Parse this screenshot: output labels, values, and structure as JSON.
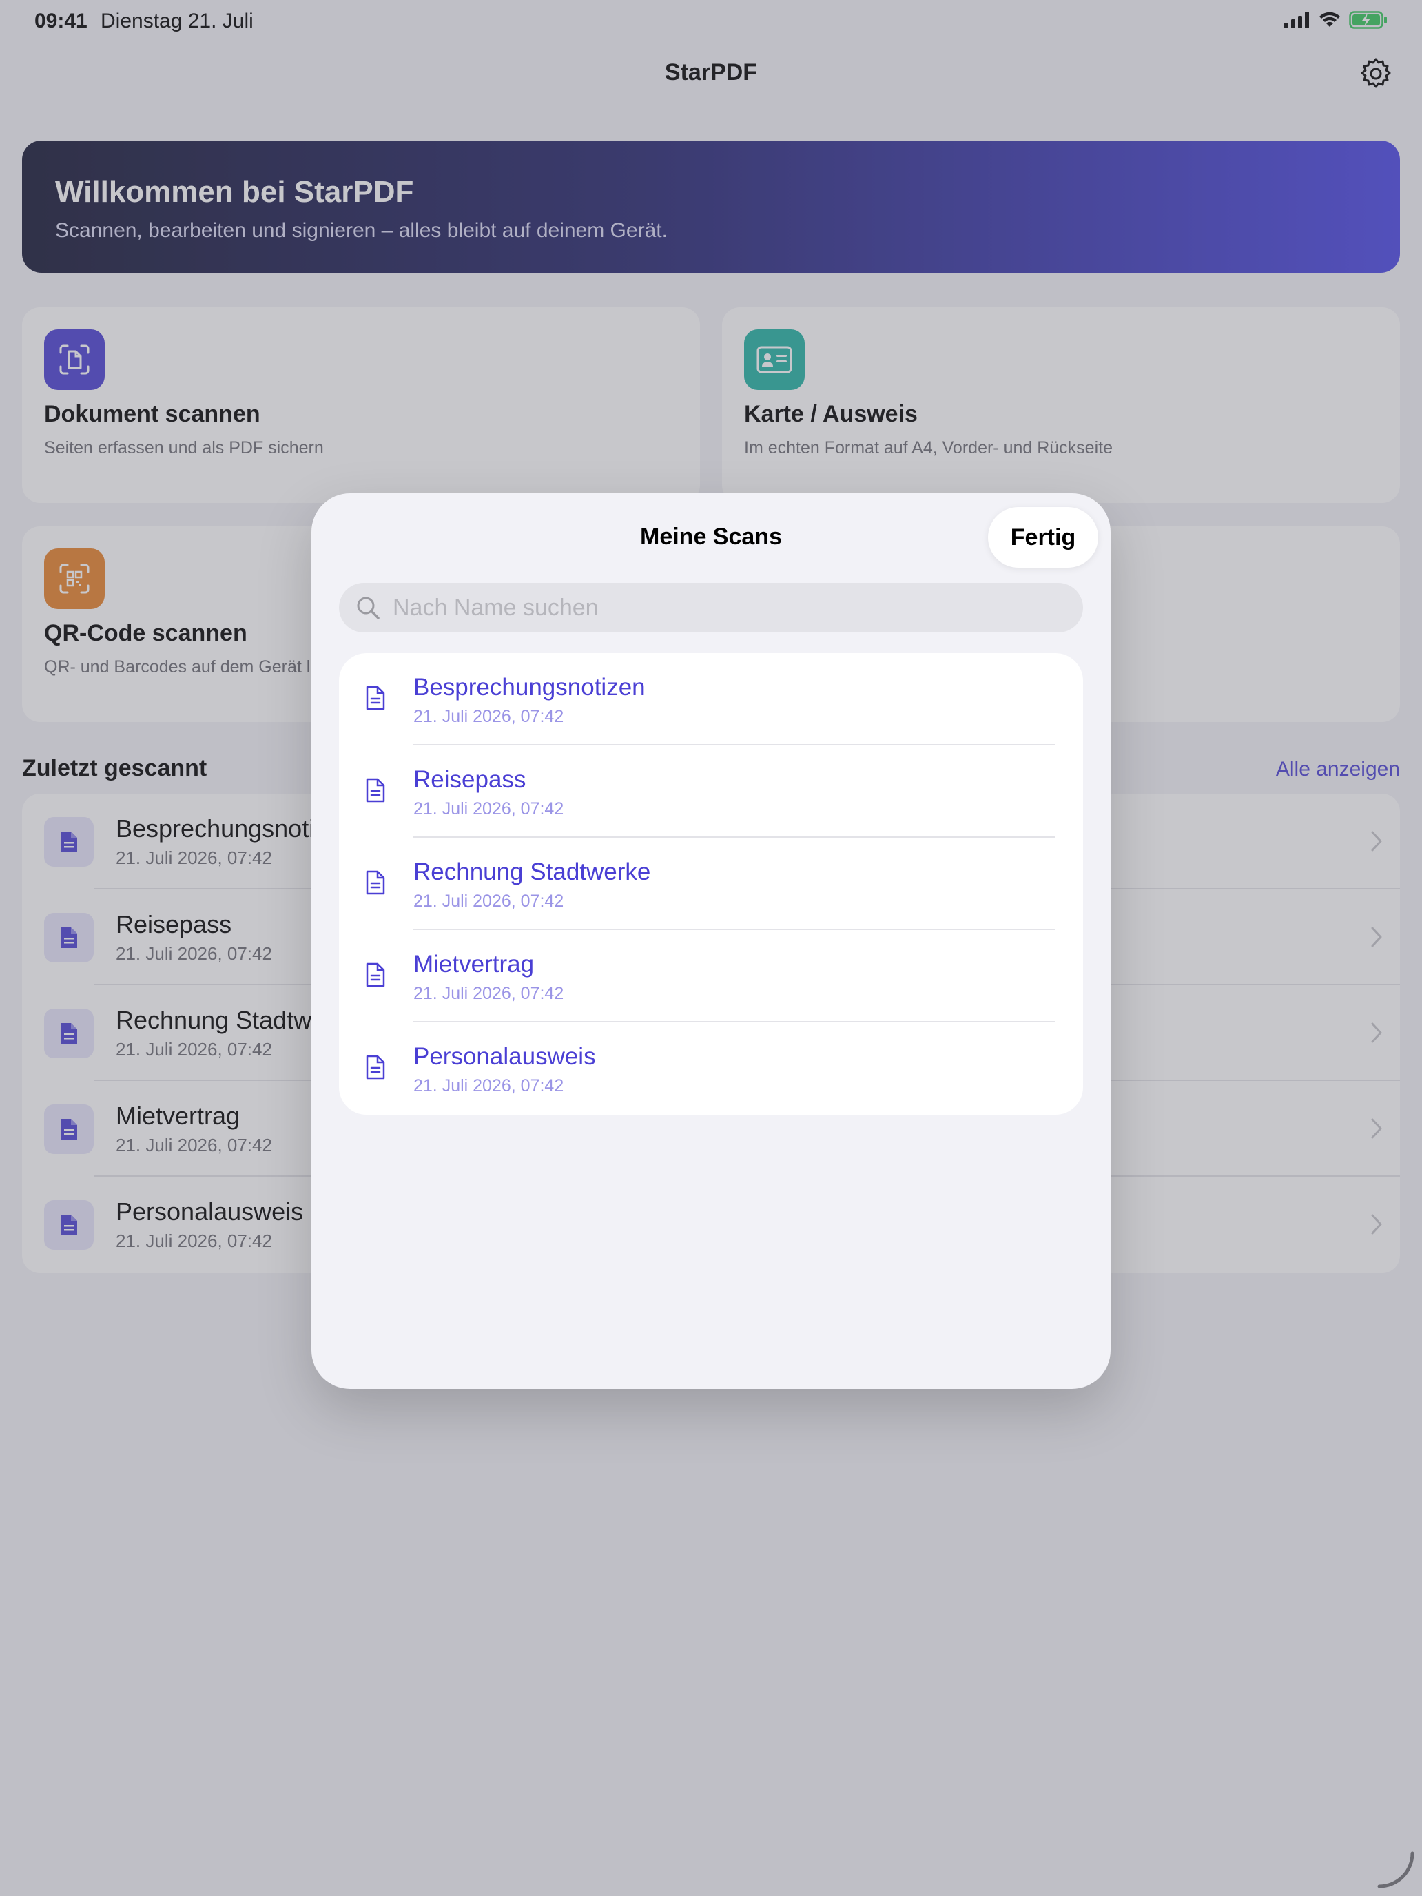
{
  "status_bar": {
    "time": "09:41",
    "date": "Dienstag 21. Juli"
  },
  "nav": {
    "title": "StarPDF",
    "settings_icon": "gear-icon"
  },
  "banner": {
    "title": "Willkommen bei StarPDF",
    "subtitle": "Scannen, bearbeiten und signieren – alles bleibt auf deinem Gerät."
  },
  "cards": [
    {
      "title": "Dokument scannen",
      "subtitle": "Seiten erfassen und als PDF sichern",
      "icon": "document-scan-icon",
      "color": "#4a3fd4"
    },
    {
      "title": "Karte / Ausweis",
      "subtitle": "Im echten Format auf A4, Vorder- und Rückseite",
      "icon": "id-card-icon",
      "color": "#22b3a3"
    },
    {
      "title": "QR-Code scannen",
      "subtitle": "QR- und Barcodes auf dem Gerät l",
      "icon": "qr-code-icon",
      "color": "#e8822a"
    }
  ],
  "recent": {
    "title": "Zuletzt gescannt",
    "show_all": "Alle anzeigen",
    "items": [
      {
        "title": "Besprechungsnotiz",
        "date": "21. Juli 2026, 07:42"
      },
      {
        "title": "Reisepass",
        "date": "21. Juli 2026, 07:42"
      },
      {
        "title": "Rechnung Stadtwe",
        "date": "21. Juli 2026, 07:42"
      },
      {
        "title": "Mietvertrag",
        "date": "21. Juli 2026, 07:42"
      },
      {
        "title": "Personalausweis",
        "date": "21. Juli 2026, 07:42"
      }
    ]
  },
  "sheet": {
    "title": "Meine Scans",
    "done_label": "Fertig",
    "search": {
      "placeholder": "Nach Name suchen",
      "value": ""
    },
    "scans": [
      {
        "title": "Besprechungsnotizen",
        "date": "21. Juli 2026, 07:42"
      },
      {
        "title": "Reisepass",
        "date": "21. Juli 2026, 07:42"
      },
      {
        "title": "Rechnung Stadtwerke",
        "date": "21. Juli 2026, 07:42"
      },
      {
        "title": "Mietvertrag",
        "date": "21. Juli 2026, 07:42"
      },
      {
        "title": "Personalausweis",
        "date": "21. Juli 2026, 07:42"
      }
    ]
  },
  "colors": {
    "accent": "#4a3fd4",
    "battery": "#34c759"
  }
}
